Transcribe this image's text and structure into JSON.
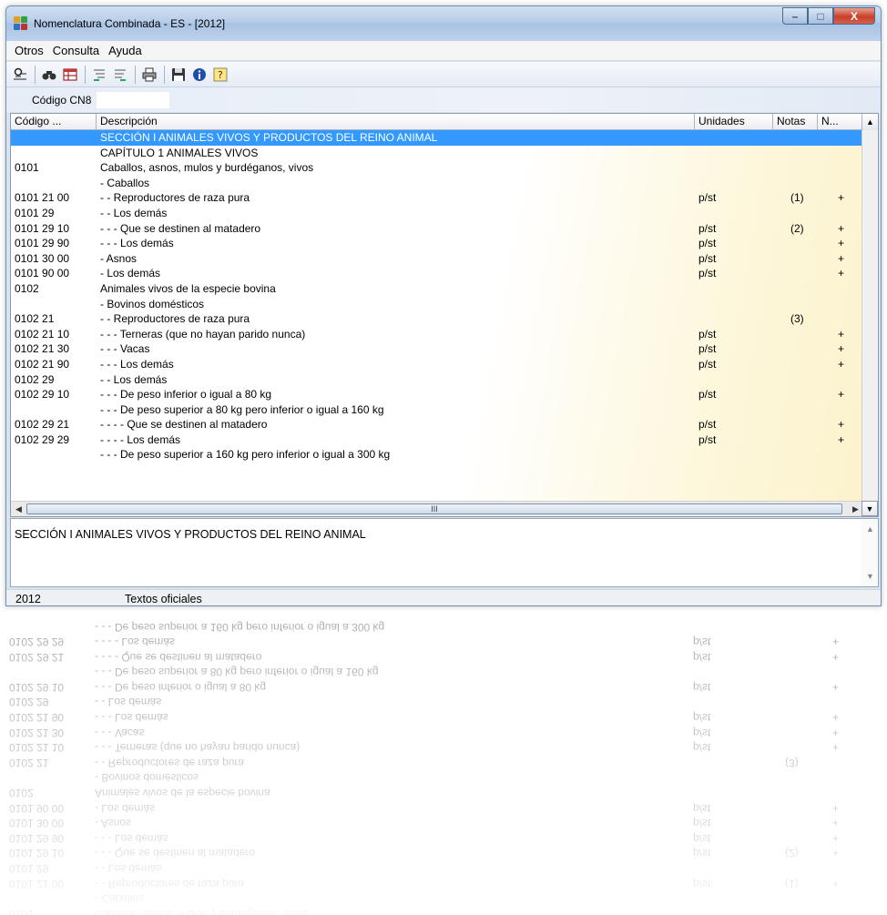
{
  "window": {
    "title": "Nomenclatura Combinada - ES - [2012]",
    "controls": {
      "minimize": "–",
      "maximize": "□",
      "close": "X"
    }
  },
  "menu": [
    "Otros",
    "Consulta",
    "Ayuda"
  ],
  "toolbar": {
    "icons": [
      "search-filter-icon",
      "binoculars-icon",
      "table-icon",
      "expand-tree-icon",
      "collapse-tree-icon",
      "print-icon",
      "save-icon",
      "info-icon",
      "help-icon"
    ]
  },
  "code_filter": {
    "label": "Código CN8",
    "value": ""
  },
  "grid": {
    "columns": [
      "Código ...",
      "Descripción",
      "Unidades",
      "Notas",
      "N..."
    ],
    "rows": [
      {
        "code": "",
        "desc": "SECCIÓN I ANIMALES VIVOS Y PRODUCTOS DEL REINO ANIMAL",
        "unit": "",
        "note": "",
        "n": "",
        "selected": true
      },
      {
        "code": "",
        "desc": "CAPÍTULO 1 ANIMALES VIVOS",
        "unit": "",
        "note": "",
        "n": ""
      },
      {
        "code": "0101",
        "desc": "Caballos, asnos, mulos y burdéganos, vivos",
        "unit": "",
        "note": "",
        "n": ""
      },
      {
        "code": "",
        "desc": "- Caballos",
        "unit": "",
        "note": "",
        "n": ""
      },
      {
        "code": "0101 21 00",
        "desc": "- - Reproductores de raza pura",
        "unit": "p/st",
        "note": "(1)",
        "n": "+"
      },
      {
        "code": "0101 29",
        "desc": "- - Los demás",
        "unit": "",
        "note": "",
        "n": ""
      },
      {
        "code": "0101 29 10",
        "desc": "- - - Que se destinen al matadero",
        "unit": "p/st",
        "note": "(2)",
        "n": "+"
      },
      {
        "code": "0101 29 90",
        "desc": "- - - Los demás",
        "unit": "p/st",
        "note": "",
        "n": "+"
      },
      {
        "code": "0101 30 00",
        "desc": "- Asnos",
        "unit": "p/st",
        "note": "",
        "n": "+"
      },
      {
        "code": "0101 90 00",
        "desc": "- Los demás",
        "unit": "p/st",
        "note": "",
        "n": "+"
      },
      {
        "code": "0102",
        "desc": "Animales vivos de la especie bovina",
        "unit": "",
        "note": "",
        "n": ""
      },
      {
        "code": "",
        "desc": "- Bovinos domésticos",
        "unit": "",
        "note": "",
        "n": ""
      },
      {
        "code": "0102 21",
        "desc": "- - Reproductores de raza pura",
        "unit": "",
        "note": "(3)",
        "n": ""
      },
      {
        "code": "0102 21 10",
        "desc": "- - - Terneras (que no hayan parido nunca)",
        "unit": "p/st",
        "note": "",
        "n": "+"
      },
      {
        "code": "0102 21 30",
        "desc": "- - - Vacas",
        "unit": "p/st",
        "note": "",
        "n": "+"
      },
      {
        "code": "0102 21 90",
        "desc": "- - - Los demás",
        "unit": "p/st",
        "note": "",
        "n": "+"
      },
      {
        "code": "0102 29",
        "desc": "- - Los demás",
        "unit": "",
        "note": "",
        "n": ""
      },
      {
        "code": "0102 29 10",
        "desc": "- - - De peso inferior o igual a 80 kg",
        "unit": "p/st",
        "note": "",
        "n": "+"
      },
      {
        "code": "",
        "desc": "- - - De peso superior a 80 kg pero inferior o igual a 160 kg",
        "unit": "",
        "note": "",
        "n": ""
      },
      {
        "code": "0102 29 21",
        "desc": "- - - - Que se destinen al matadero",
        "unit": "p/st",
        "note": "",
        "n": "+"
      },
      {
        "code": "0102 29 29",
        "desc": "- - - - Los demás",
        "unit": "p/st",
        "note": "",
        "n": "+"
      },
      {
        "code": "",
        "desc": "- - - De peso superior a 160 kg pero inferior o igual a 300 kg",
        "unit": "",
        "note": "",
        "n": ""
      }
    ],
    "scroll_thumb_glyph": "III"
  },
  "detail": {
    "text": "SECCIÓN I ANIMALES VIVOS Y PRODUCTOS DEL REINO ANIMAL"
  },
  "status": {
    "year": "2012",
    "label": "Textos oficiales"
  }
}
